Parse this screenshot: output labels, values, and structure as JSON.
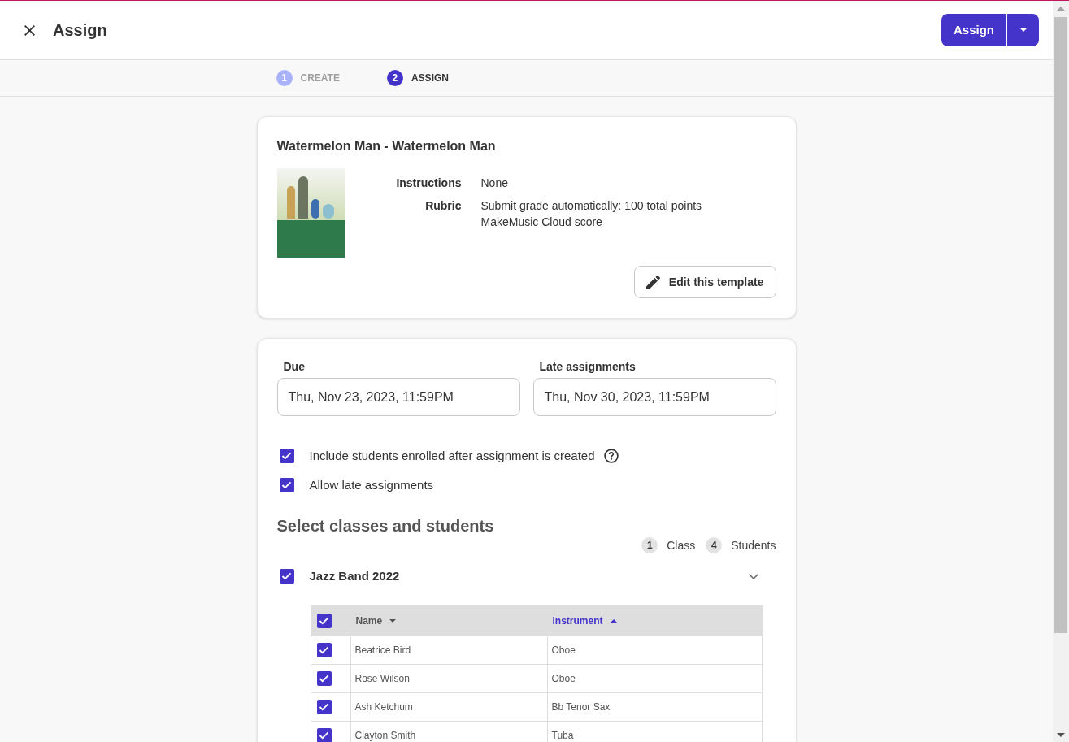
{
  "header": {
    "title": "Assign",
    "assign_button": "Assign"
  },
  "stepper": [
    {
      "number": "1",
      "label": "CREATE",
      "selected": false
    },
    {
      "number": "2",
      "label": "ASSIGN",
      "selected": true
    }
  ],
  "template_card": {
    "title": "Watermelon Man - Watermelon Man",
    "details": [
      {
        "label": "Instructions",
        "lines": [
          "None"
        ]
      },
      {
        "label": "Rubric",
        "lines": [
          "Submit grade automatically: 100 total points",
          "MakeMusic Cloud score"
        ]
      }
    ],
    "edit_button": "Edit this template"
  },
  "dates": [
    {
      "label": "Due",
      "value": "Thu, Nov 23, 2023, 11:59PM"
    },
    {
      "label": "Late assignments",
      "value": "Thu, Nov 30, 2023, 11:59PM"
    }
  ],
  "options": [
    {
      "label": "Include students enrolled after assignment is created",
      "checked": true,
      "help": true
    },
    {
      "label": "Allow late assignments",
      "checked": true
    }
  ],
  "selection": {
    "heading": "Select classes and students",
    "counts": [
      {
        "count": "1",
        "label": "Class"
      },
      {
        "count": "4",
        "label": "Students"
      }
    ],
    "classes": [
      {
        "name": "Jazz Band 2022",
        "checked": true,
        "expanded": true,
        "table": {
          "all_checked": true,
          "columns": [
            {
              "label": "Name",
              "selected": false,
              "ascending": false
            },
            {
              "label": "Instrument",
              "selected": true,
              "ascending": true
            }
          ],
          "rows": [
            {
              "checked": true,
              "cells": [
                "Beatrice Bird",
                "Oboe"
              ]
            },
            {
              "checked": true,
              "cells": [
                "Rose Wilson",
                "Oboe"
              ]
            },
            {
              "checked": true,
              "cells": [
                "Ash Ketchum",
                "Bb Tenor Sax"
              ]
            },
            {
              "checked": true,
              "cells": [
                "Clayton Smith",
                "Tuba"
              ]
            }
          ]
        }
      }
    ]
  }
}
